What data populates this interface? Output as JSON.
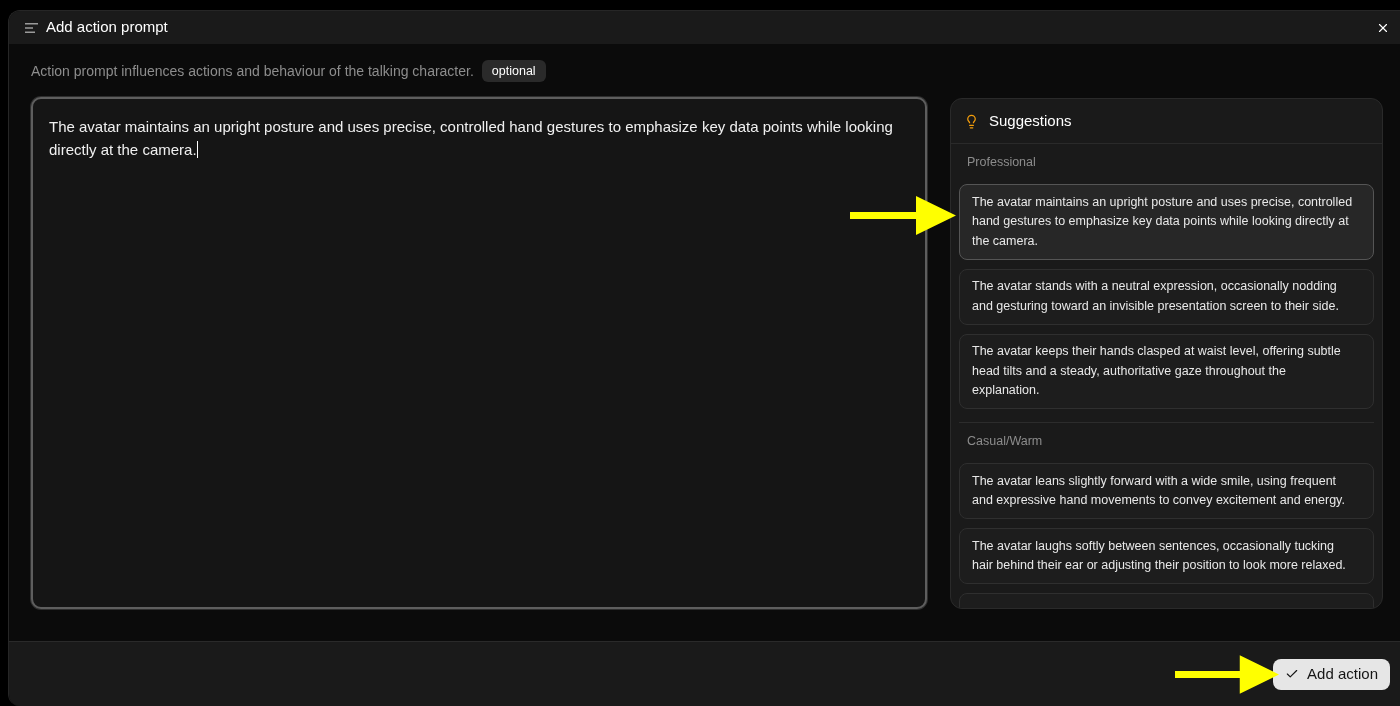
{
  "window": {
    "title": "Add action prompt"
  },
  "intro": {
    "text": "Action prompt influences actions and behaviour of the talking character.",
    "badge": "optional"
  },
  "prompt_field": {
    "value": "The avatar maintains an upright posture and uses precise, controlled hand gestures to emphasize key data points while looking directly at the camera.",
    "focused": true
  },
  "suggestions": {
    "title": "Suggestions",
    "sections": [
      {
        "label": "Professional",
        "items": [
          {
            "kind": "full",
            "text": "The avatar maintains an upright posture and uses precise, controlled hand gestures to emphasize key data points while looking directly at the camera.",
            "selected": true
          },
          {
            "kind": "full",
            "text": "The avatar stands with a neutral expression, occasionally nodding and gesturing toward an invisible presentation screen to their side.",
            "selected": false
          },
          {
            "kind": "full",
            "text": "The avatar keeps their hands clasped at waist level, offering subtle head tilts and a steady, authoritative gaze throughout the explanation.",
            "selected": false
          }
        ]
      },
      {
        "label": "Casual/Warm",
        "items": [
          {
            "kind": "full",
            "text": "The avatar leans slightly forward with a wide smile, using frequent and expressive hand movements to convey excitement and energy.",
            "selected": false
          },
          {
            "kind": "full",
            "text": "The avatar laughs softly between sentences, occasionally tucking hair behind their ear or adjusting their position to look more relaxed.",
            "selected": false
          },
          {
            "kind": "cut_off",
            "selected": false
          }
        ]
      }
    ]
  },
  "footer": {
    "confirm_button": "Add action"
  }
}
